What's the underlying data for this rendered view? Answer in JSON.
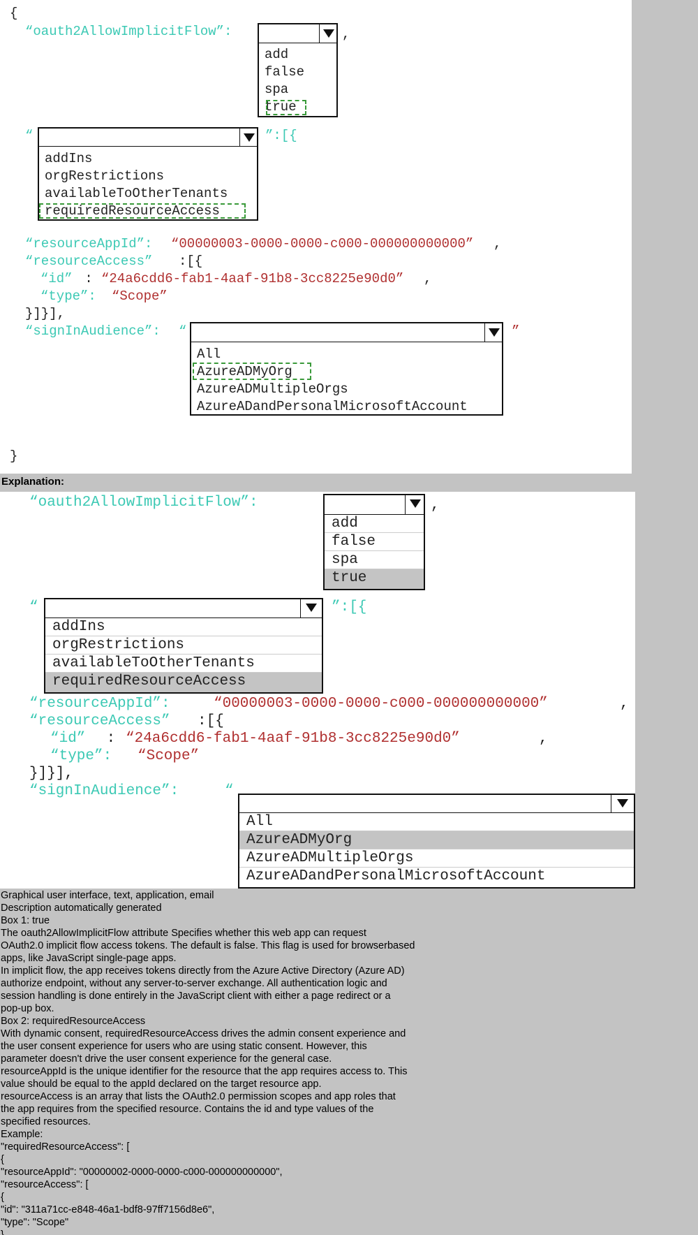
{
  "question": {
    "open_brace": "{",
    "close_brace": "}",
    "oauth_key": "“oauth2AllowImplicitFlow”:",
    "comma": ",",
    "box1_options": [
      "add",
      "false",
      "spa",
      "true"
    ],
    "box1_selected": "true",
    "quote_open": "“",
    "box2_suffix": "”:[{",
    "box2_options": [
      "addIns",
      "orgRestrictions",
      "availableToOtherTenants",
      "requiredResourceAccess"
    ],
    "box2_selected": "requiredResourceAccess",
    "resource_app_id_key": "“resourceAppId”:",
    "resource_app_id_value": "“00000003-0000-0000-c000-000000000000”",
    "resource_access_key": "“resourceAccess”",
    "resource_access_open": ":[{",
    "id_key": "“id”",
    "id_colon": " : ",
    "id_value": "“24a6cdd6-fab1-4aaf-91b8-3cc8225e90d0”",
    "type_key": "“type”:",
    "type_value": "“Scope”",
    "closing_brackets": "}]}],",
    "sign_in_key": "“signInAudience”:",
    "sign_in_quote": "“",
    "sign_in_close_quote": "”",
    "box3_options": [
      "All",
      "AzureADMyOrg",
      "AzureADMultipleOrgs",
      "AzureADandPersonalMicrosoftAccount"
    ],
    "box3_selected": "AzureADMyOrg"
  },
  "explanation": {
    "heading": "Explanation:",
    "lines": [
      "Graphical user interface, text, application, email",
      "Description automatically generated",
      "Box 1: true",
      "The oauth2AllowImplicitFlow attribute Specifies whether this web app can request",
      "OAuth2.0 implicit flow access tokens. The default is false. This flag is used for browserbased",
      "apps, like JavaScript single-page apps.",
      "In implicit flow, the app receives tokens directly from the Azure Active Directory (Azure AD)",
      "authorize endpoint, without any server-to-server exchange. All authentication logic and",
      "session handling is done entirely in the JavaScript client with either a page redirect or a",
      "pop-up box.",
      "Box 2: requiredResourceAccess",
      "With dynamic consent, requiredResourceAccess drives the admin consent experience and",
      "the user consent experience for users who are using static consent. However, this",
      "parameter doesn't drive the user consent experience for the general case.",
      "resourceAppId is the unique identifier for the resource that the app requires access to. This",
      "value should be equal to the appId declared on the target resource app.",
      "resourceAccess is an array that lists the OAuth2.0 permission scopes and app roles that",
      "the app requires from the specified resource. Contains the id and type values of the",
      "specified resources.",
      "Example:",
      "\"requiredResourceAccess\": [",
      "{",
      "\"resourceAppId\": \"00000002-0000-0000-c000-000000000000\",",
      "\"resourceAccess\": [",
      "{",
      "\"id\": \"311a71cc-e848-46a1-bdf8-97ff7156d8e6\",",
      "\"type\": \"Scope\"",
      "}"
    ]
  }
}
